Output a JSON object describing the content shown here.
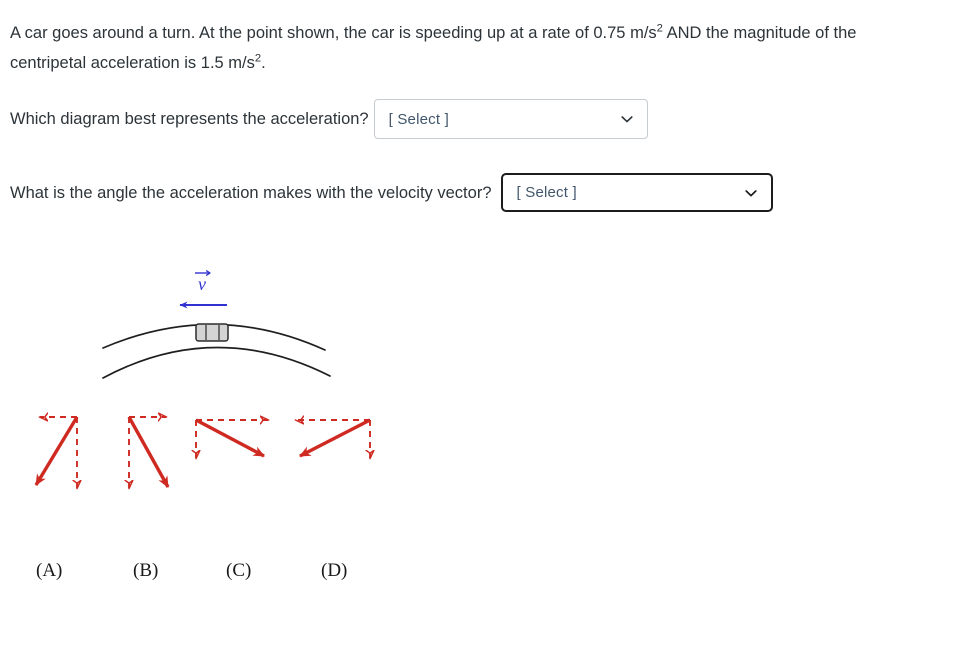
{
  "question": {
    "stem_part1": "A car goes around a turn. At the point shown, the car is speeding up at a rate of 0.75 m/s",
    "stem_exp1": "2",
    "stem_part2": " AND the magnitude of the centripetal acceleration is 1.5 m/s",
    "stem_exp2": "2",
    "stem_part3": "."
  },
  "prompts": {
    "diagram": {
      "label": "Which diagram best represents the acceleration?",
      "select_value": "[ Select ]",
      "chevron_icon": "chevron-down-icon"
    },
    "angle": {
      "label": "What is the angle the acceleration makes with the velocity vector?",
      "select_value": "[ Select ]",
      "chevron_icon": "chevron-down-icon"
    }
  },
  "figure": {
    "velocity_label": "v",
    "velocity_direction": "left",
    "velocity_color": "#3232d2",
    "road_color": "#1f1f1f",
    "car_fill": "#d4d4d4",
    "car_stroke": "#2b2b2b",
    "vector_color": "#cf2a21",
    "options": [
      {
        "id": "A",
        "label": "(A)",
        "resultant": "up-right-to-down-left-steep",
        "dashed_horizontal": "left-short",
        "dashed_vertical": "down-long"
      },
      {
        "id": "B",
        "label": "(B)",
        "resultant": "up-left-to-down-right-steep",
        "dashed_horizontal": "right-short",
        "dashed_vertical": "down-long"
      },
      {
        "id": "C",
        "label": "(C)",
        "resultant": "up-left-to-down-right-shallow",
        "dashed_horizontal": "right-long",
        "dashed_vertical": "down-short"
      },
      {
        "id": "D",
        "label": "(D)",
        "resultant": "up-right-to-down-left-shallow",
        "dashed_horizontal": "left-long",
        "dashed_vertical": "down-short"
      }
    ]
  }
}
